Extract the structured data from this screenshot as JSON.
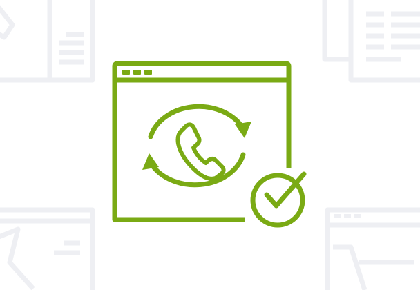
{
  "illustration": {
    "icon": "browser-callback-check-icon",
    "accent_color": "#7aaa14",
    "background_color": "#ffffff",
    "decoration_color": "#eeeff3",
    "background_icons": [
      "form-document-icon",
      "list-document-icon",
      "browser-window-icon",
      "browser-cart-icon"
    ]
  }
}
